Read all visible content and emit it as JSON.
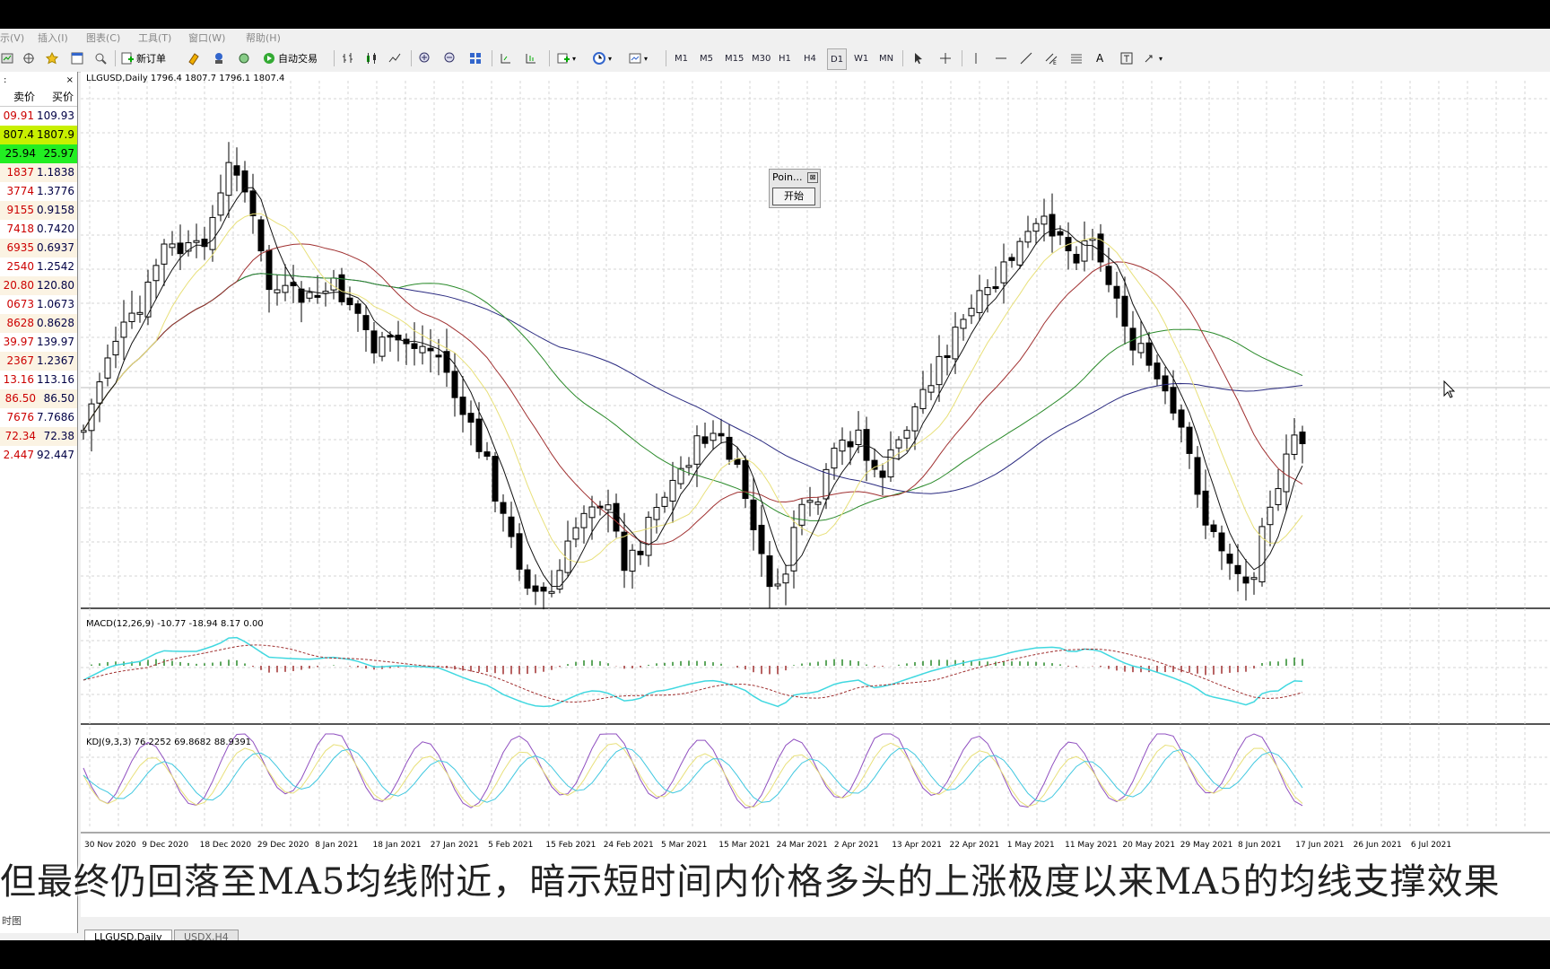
{
  "menu": [
    "示(V)",
    "插入(I)",
    "图表(C)",
    "工具(T)",
    "窗口(W)",
    "帮助(H)"
  ],
  "toolbar": {
    "new_order": "新订单",
    "auto_trading": "自动交易",
    "timeframes": [
      "M1",
      "M5",
      "M15",
      "M30",
      "H1",
      "H4",
      "D1",
      "W1",
      "MN"
    ]
  },
  "watch": {
    "close_glyph": "×",
    "col_bid": "卖价",
    "col_ask": "买价",
    "rows": [
      {
        "bid": "09.91",
        "ask": "109.93",
        "hl": ""
      },
      {
        "bid": "807.4",
        "ask": "1807.9",
        "hl": "#c8f000"
      },
      {
        "bid": "25.94",
        "ask": "25.97",
        "hl": "#22ee22"
      },
      {
        "bid": "1837",
        "ask": "1.1838",
        "hl": ""
      },
      {
        "bid": "3774",
        "ask": "1.3776",
        "hl": ""
      },
      {
        "bid": "9155",
        "ask": "0.9158",
        "hl": ""
      },
      {
        "bid": "7418",
        "ask": "0.7420",
        "hl": ""
      },
      {
        "bid": "6935",
        "ask": "0.6937",
        "hl": ""
      },
      {
        "bid": "2540",
        "ask": "1.2542",
        "hl": ""
      },
      {
        "bid": "20.80",
        "ask": "120.80",
        "hl": ""
      },
      {
        "bid": "0673",
        "ask": "1.0673",
        "hl": ""
      },
      {
        "bid": "8628",
        "ask": "0.8628",
        "hl": ""
      },
      {
        "bid": "39.97",
        "ask": "139.97",
        "hl": ""
      },
      {
        "bid": "2367",
        "ask": "1.2367",
        "hl": ""
      },
      {
        "bid": "13.16",
        "ask": "113.16",
        "hl": ""
      },
      {
        "bid": "86.50",
        "ask": "86.50",
        "hl": ""
      },
      {
        "bid": "7676",
        "ask": "7.7686",
        "hl": ""
      },
      {
        "bid": "72.34",
        "ask": "72.38",
        "hl": ""
      },
      {
        "bid": "2.447",
        "ask": "92.447",
        "hl": ""
      }
    ],
    "bottom_tab": "时图"
  },
  "chart": {
    "ohlc_label": "LLGUSD,Daily  1796.4 1807.7 1796.1 1807.4",
    "macd_label": "MACD(12,26,9) -10.77 -18.94 8.17 0.00",
    "kdj_label": "KDJ(9,3,3) 76.2252 69.8682 88.9391",
    "date_labels": [
      "30 Nov 2020",
      "9 Dec 2020",
      "18 Dec 2020",
      "29 Dec 2020",
      "8 Jan 2021",
      "18 Jan 2021",
      "27 Jan 2021",
      "5 Feb 2021",
      "15 Feb 2021",
      "24 Feb 2021",
      "5 Mar 2021",
      "15 Mar 2021",
      "24 Mar 2021",
      "2 Apr 2021",
      "13 Apr 2021",
      "22 Apr 2021",
      "1 May 2021",
      "11 May 2021",
      "20 May 2021",
      "29 May 2021",
      "8 Jun 2021",
      "17 Jun 2021",
      "26 Jun 2021",
      "6 Jul 2021"
    ],
    "ma_colors": {
      "ma5": "#111111",
      "ma10": "#e8e07a",
      "ma20": "#a03030",
      "ma40": "#2a8a2a",
      "ma60": "#2a2a80"
    }
  },
  "popup": {
    "title": "Poin...",
    "close_glyph": "⊠",
    "start_label": "开始"
  },
  "tabs": [
    "LLGUSD,Daily",
    "USDX,H4"
  ],
  "subtitle": "但最终仍回落至MA5均线附近，暗示短时间内价格多头的上涨极度以来MA5的均线支撑效果"
}
